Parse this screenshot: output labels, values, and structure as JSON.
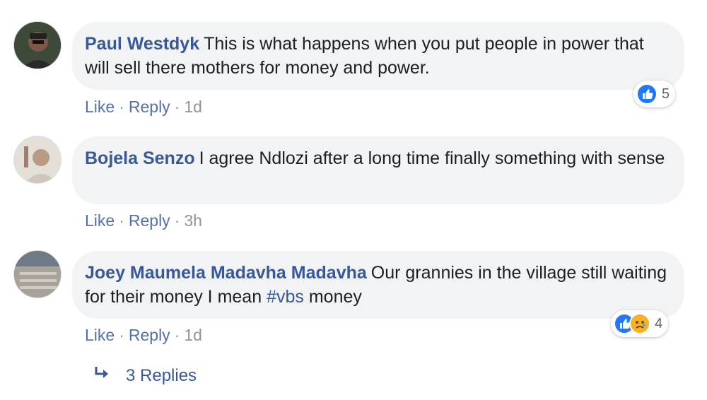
{
  "comments": [
    {
      "author": "Paul Westdyk",
      "text": "This is what happens when you put people in power that will sell there mothers for money and power.",
      "actions": {
        "like": "Like",
        "reply": "Reply",
        "time": "1d",
        "sep": "·"
      },
      "reactions": {
        "icons": [
          "like-icon"
        ],
        "count": "5"
      }
    },
    {
      "author": "Bojela Senzo",
      "text": "I agree Ndlozi after a long time finally something with sense",
      "actions": {
        "like": "Like",
        "reply": "Reply",
        "time": "3h",
        "sep": "·"
      }
    },
    {
      "author": "Joey Maumela Madavha Madavha",
      "text_before": "Our grannies in the village still waiting for their money I mean",
      "hashtag": "#vbs",
      "text_after": "money",
      "actions": {
        "like": "Like",
        "reply": "Reply",
        "time": "1d",
        "sep": "·"
      },
      "reactions": {
        "icons": [
          "like-icon",
          "sad-icon"
        ],
        "count": "4"
      }
    }
  ],
  "replies_link": {
    "label": "3 Replies",
    "icon": "reply-arrow-icon"
  },
  "colors": {
    "author": "#385898",
    "bubble": "#f2f3f5",
    "like": "#2078f4",
    "sad": "#f7b125",
    "meta": "#90949c"
  }
}
